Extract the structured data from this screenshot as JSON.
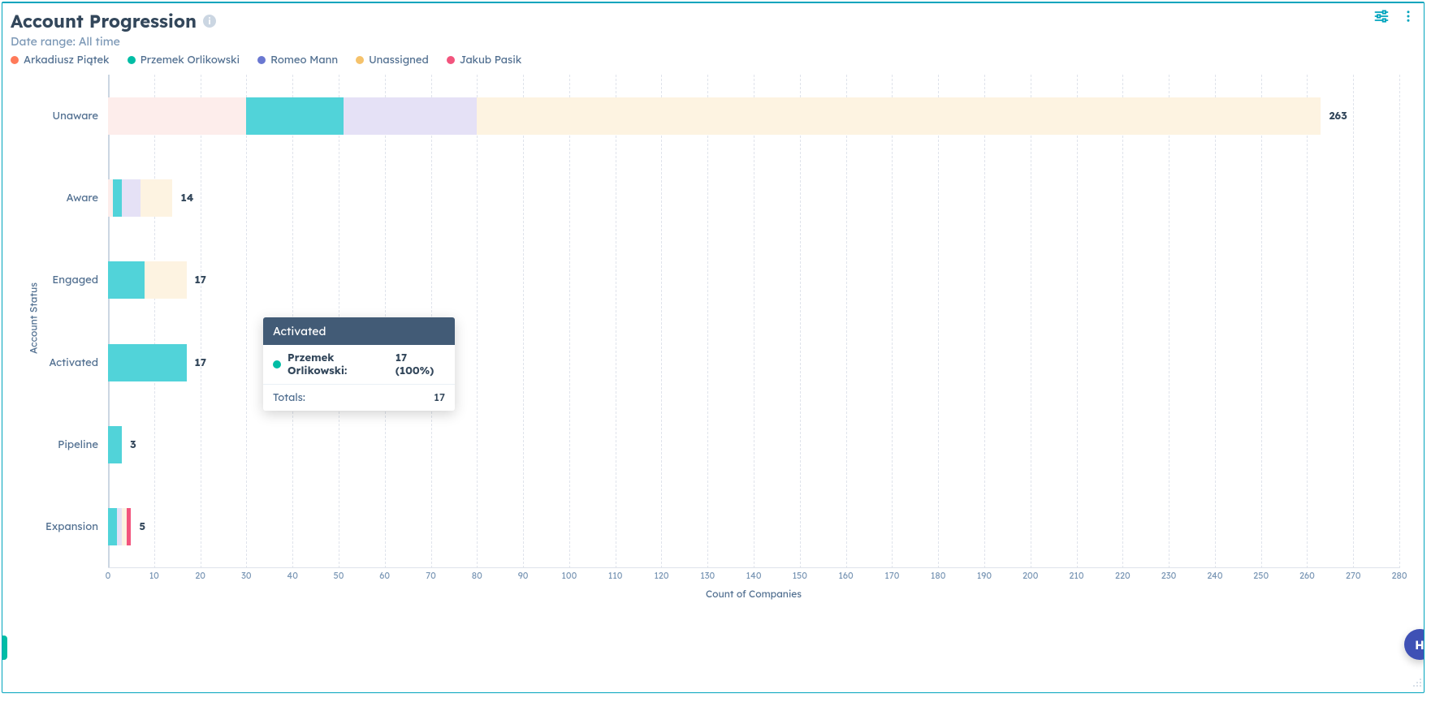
{
  "title": "Account Progression",
  "subtitle": "Date range: All time",
  "x_axis_title": "Count of Companies",
  "y_axis_title": "Account Status",
  "colors": {
    "Arkadiusz Piątek": "#fdedeb",
    "Przemek Orlikowski": "#51d3d9",
    "Romeo Mann": "#e5e1f6",
    "Unassigned": "#fdf3e1",
    "Jakub Pasik": "#f2547d"
  },
  "legend_swatch": {
    "Arkadiusz Piątek": "#ff7a59",
    "Przemek Orlikowski": "#00bda5",
    "Romeo Mann": "#6a78d1",
    "Unassigned": "#f5c26b",
    "Jakub Pasik": "#f2547d"
  },
  "tooltip": {
    "category": "Activated",
    "series_name": "Przemek Orlikowski",
    "series_value": "17 (100%)",
    "totals_label": "Totals:",
    "totals_value": "17"
  },
  "fab_letter": "H",
  "chart_data": {
    "type": "bar",
    "orientation": "horizontal",
    "stacked": true,
    "title": "Account Progression",
    "xlabel": "Count of Companies",
    "ylabel": "Account Status",
    "xlim": [
      0,
      280
    ],
    "x_ticks": [
      0,
      10,
      20,
      30,
      40,
      50,
      60,
      70,
      80,
      90,
      100,
      110,
      120,
      130,
      140,
      150,
      160,
      170,
      180,
      190,
      200,
      210,
      220,
      230,
      240,
      250,
      260,
      270,
      280
    ],
    "categories": [
      "Unaware",
      "Aware",
      "Engaged",
      "Activated",
      "Pipeline",
      "Expansion"
    ],
    "series": [
      {
        "name": "Arkadiusz Piątek",
        "values": [
          30,
          1,
          0,
          0,
          0,
          0
        ]
      },
      {
        "name": "Przemek Orlikowski",
        "values": [
          21,
          2,
          8,
          17,
          3,
          2
        ]
      },
      {
        "name": "Romeo Mann",
        "values": [
          29,
          4,
          0,
          0,
          0,
          1
        ]
      },
      {
        "name": "Unassigned",
        "values": [
          183,
          7,
          9,
          0,
          0,
          1
        ]
      },
      {
        "name": "Jakub Pasik",
        "values": [
          0,
          0,
          0,
          0,
          0,
          1
        ]
      }
    ],
    "totals": [
      263,
      14,
      17,
      17,
      3,
      5
    ]
  }
}
